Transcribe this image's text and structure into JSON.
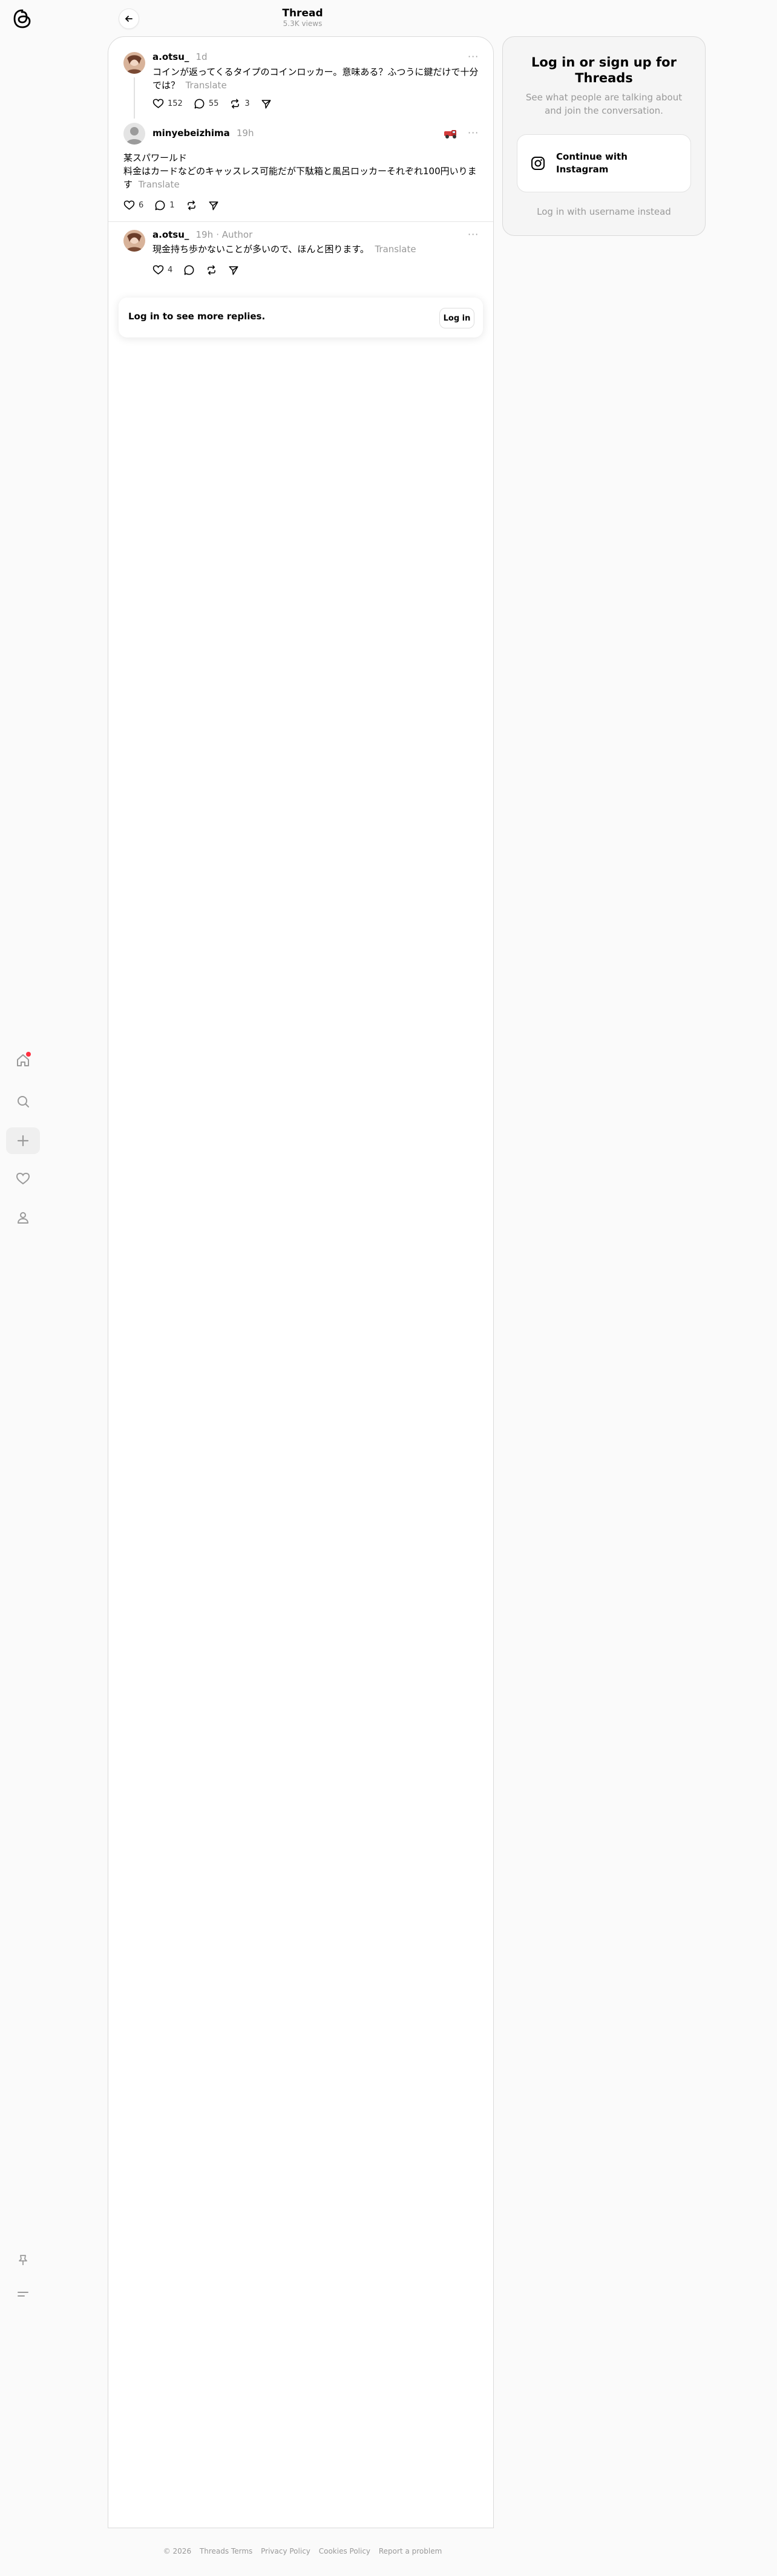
{
  "header": {
    "title": "Thread",
    "views": "5.3K views"
  },
  "posts": [
    {
      "username": "a.otsu_",
      "time": "1d",
      "text": "コインが返ってくるタイプのコインロッカー。意味ある？ふつうに鍵だけで十分では？",
      "translate": "Translate",
      "likes": "152",
      "replies": "55",
      "reposts": "3"
    },
    {
      "username": "minyebeizhima",
      "time": "19h",
      "line1": "某スパワールド",
      "line2": "料金はカードなどのキャッスレス可能だが下駄箱と風呂ロッカーそれぞれ100円いります",
      "translate": "Translate",
      "likes": "6",
      "replies": "1"
    },
    {
      "username": "a.otsu_",
      "time": "19h",
      "badge": "Author",
      "text": "現金持ち歩かないことが多いので、ほんと困ります。",
      "translate": "Translate",
      "likes": "4"
    }
  ],
  "login_strip": {
    "text": "Log in to see more replies.",
    "button": "Log in"
  },
  "side": {
    "title": "Log in or sign up for Threads",
    "subtitle": "See what people are talking about and join the conversation.",
    "instagram_button": "Continue with Instagram",
    "alt_login": "Log in with username instead"
  },
  "footer": {
    "copyright": "© 2026",
    "links": [
      "Threads Terms",
      "Privacy Policy",
      "Cookies Policy",
      "Report a problem"
    ]
  },
  "colors": {
    "notification_dot": "#ff3040",
    "muted": "#999999"
  }
}
